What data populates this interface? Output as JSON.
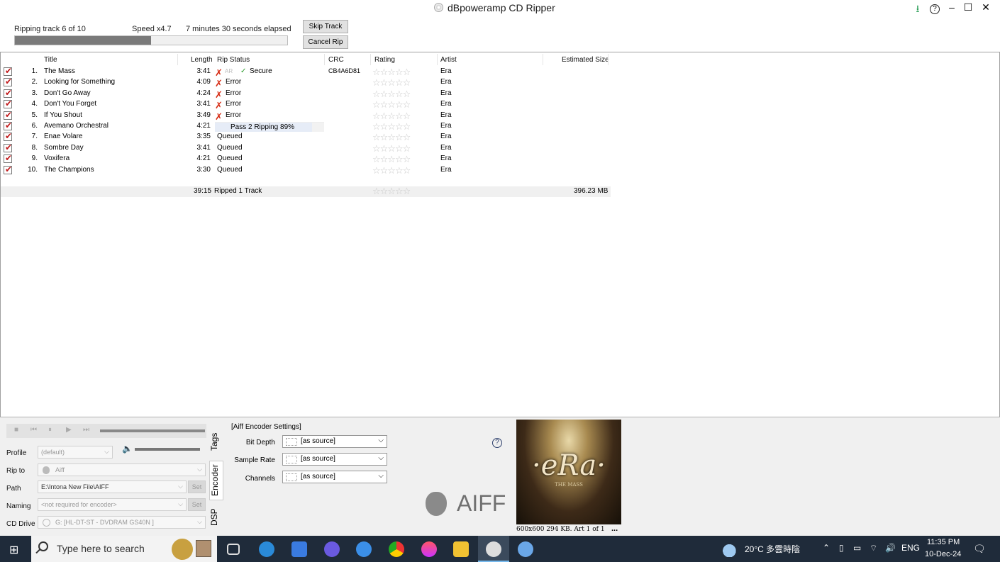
{
  "window": {
    "title": "dBpoweramp CD Ripper",
    "controls": {
      "download": "⭳",
      "help": "?",
      "minimize": "–",
      "maximize": "☐",
      "close": "✕"
    }
  },
  "rip": {
    "status": "Ripping track 6 of 10",
    "speed": "Speed x4.7",
    "elapsed": "7 minutes 30 seconds elapsed",
    "progress": 0.5,
    "skip_label": "Skip Track",
    "cancel_label": "Cancel Rip"
  },
  "columns": {
    "title": "Title",
    "length": "Length",
    "rip_status": "Rip Status",
    "crc": "CRC",
    "rating": "Rating",
    "artist": "Artist",
    "size": "Estimated Size"
  },
  "tracks": [
    {
      "num": "1.",
      "title": "The Mass",
      "length": "3:41",
      "status": "Secure",
      "ar": "AR",
      "crc": "CB4A6D81",
      "artist": "Era",
      "kind": "secure"
    },
    {
      "num": "2.",
      "title": "Looking for Something",
      "length": "4:09",
      "status": "Error",
      "crc": "",
      "artist": "Era",
      "kind": "error"
    },
    {
      "num": "3.",
      "title": "Don't Go Away",
      "length": "4:24",
      "status": "Error",
      "crc": "",
      "artist": "Era",
      "kind": "error"
    },
    {
      "num": "4.",
      "title": "Don't You Forget",
      "length": "3:41",
      "status": "Error",
      "crc": "",
      "artist": "Era",
      "kind": "error"
    },
    {
      "num": "5.",
      "title": "If You Shout",
      "length": "3:49",
      "status": "Error",
      "crc": "",
      "artist": "Era",
      "kind": "error"
    },
    {
      "num": "6.",
      "title": "Avemano Orchestral",
      "length": "4:21",
      "status": "Pass 2 Ripping 89%",
      "crc": "",
      "artist": "Era",
      "kind": "ripping",
      "progress": 0.89
    },
    {
      "num": "7.",
      "title": "Enae Volare",
      "length": "3:35",
      "status": "Queued",
      "crc": "",
      "artist": "Era",
      "kind": "queued"
    },
    {
      "num": "8.",
      "title": "Sombre Day",
      "length": "3:41",
      "status": "Queued",
      "crc": "",
      "artist": "Era",
      "kind": "queued"
    },
    {
      "num": "9.",
      "title": "Voxifera",
      "length": "4:21",
      "status": "Queued",
      "crc": "",
      "artist": "Era",
      "kind": "queued"
    },
    {
      "num": "10.",
      "title": "The Champions",
      "length": "3:30",
      "status": "Queued",
      "crc": "",
      "artist": "Era",
      "kind": "queued"
    }
  ],
  "totals": {
    "length": "39:15",
    "status": "Ripped 1 Track",
    "size": "396.23 MB"
  },
  "options": {
    "profile_label": "Profile",
    "profile_value": "(default)",
    "ripto_label": "Rip to",
    "ripto_value": "Aiff",
    "path_label": "Path",
    "path_value": "E:\\Intona New File\\AIFF",
    "naming_label": "Naming",
    "naming_value": "<not required for encoder>",
    "cddrive_label": "CD Drive",
    "cddrive_value": "G:  [HL-DT-ST - DVDRAM GS40N   ]",
    "set_label": "Set"
  },
  "tabs": {
    "tags": "Tags",
    "encoder": "Encoder",
    "dsp": "DSP"
  },
  "encoder": {
    "title": "[Aiff Encoder Settings]",
    "bit_depth_label": "Bit Depth",
    "bit_depth_value": "[as source]",
    "sample_rate_label": "Sample Rate",
    "sample_rate_value": "[as source]",
    "channels_label": "Channels",
    "channels_value": "[as source]",
    "format_logo": "AIFF"
  },
  "art": {
    "logo_text": "·eRa·",
    "logo_sub": "THE MASS",
    "caption": "600x600 294 KB. Art 1 of 1",
    "more": "..."
  },
  "taskbar": {
    "search_placeholder": "Type here to search",
    "weather": "20°C 多雲時陰",
    "lang": "ENG",
    "time": "11:35 PM",
    "date": "10-Dec-24"
  }
}
